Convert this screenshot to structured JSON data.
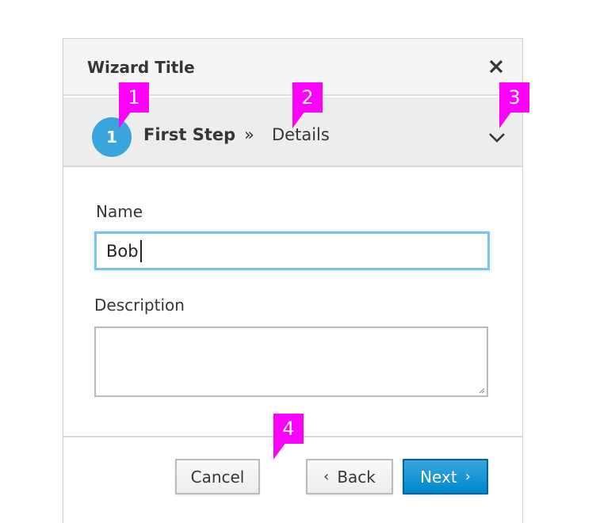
{
  "wizard": {
    "title": "Wizard Title",
    "close_icon": "close-icon"
  },
  "steps": {
    "current_number": "1",
    "current_label": "First Step",
    "separator": "»",
    "substep_label": "Details",
    "toggle_icon": "chevron-down-icon"
  },
  "form": {
    "name_label": "Name",
    "name_value": "Bob",
    "description_label": "Description",
    "description_value": ""
  },
  "footer": {
    "cancel_label": "Cancel",
    "back_label": "Back",
    "back_icon": "‹",
    "next_label": "Next",
    "next_icon": "›"
  },
  "callouts": [
    "1",
    "2",
    "3",
    "4"
  ],
  "colors": {
    "primary": "#0088ce",
    "step_circle": "#39a5dc",
    "callout": "#ff00ff",
    "focus_border": "#7dc3e8"
  }
}
